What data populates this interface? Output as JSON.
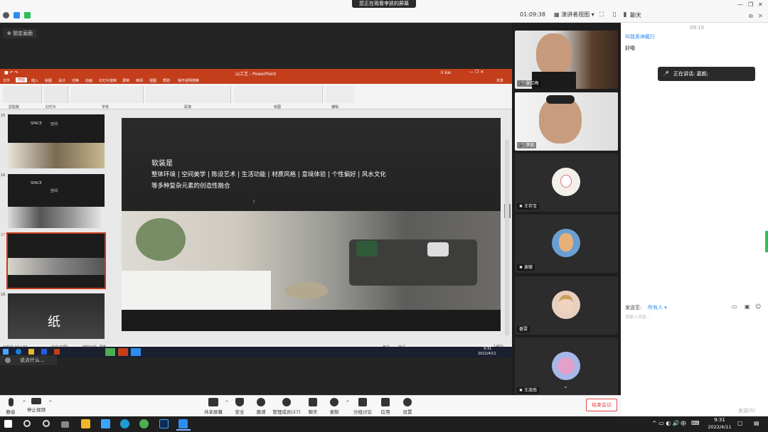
{
  "top": {
    "share_banner": "您正在观看李凯的屏幕",
    "timer": "01:09:38",
    "view_mode": "演讲者视图",
    "chat_title": "聊天"
  },
  "meeting": {
    "lock_view": "锁定画面"
  },
  "ppt": {
    "doc_title": "山工艺 - PowerPoint",
    "user": "li kai",
    "tabs": [
      "文件",
      "开始",
      "插入",
      "绘图",
      "设计",
      "切换",
      "动画",
      "幻灯片放映",
      "录制",
      "审阅",
      "视图",
      "帮助",
      "操作说明搜索"
    ],
    "share_label": "共享",
    "ribbon_groups": [
      "剪贴板",
      "幻灯片",
      "字体",
      "段落",
      "绘图",
      "编辑"
    ],
    "thumbs": [
      {
        "num": "15",
        "title": "SPACE",
        "sub": "空间"
      },
      {
        "num": "16",
        "title": "SPACE",
        "sub": "空间"
      },
      {
        "num": "17",
        "title": "",
        "sub": ""
      },
      {
        "num": "18",
        "title": "纸",
        "sub": ""
      }
    ],
    "slide": {
      "heading": "软装是",
      "line1": "整体环境 | 空间美学 | 陈设艺术 | 生活功能 | 材质风格 | 意境体验 | 个性偏好 | 风水文化",
      "line2": "等多种复杂元素的创造性融合"
    },
    "status": {
      "slide_pos": "幻灯片 17 / 37",
      "lang": "中文(中国)",
      "accessibility": "辅助功能: 调查",
      "notes": "备注",
      "comments": "批注",
      "zoom": "146%"
    },
    "taskbar_time": "9:31",
    "taskbar_date": "2022/4/11"
  },
  "notes_input": "说点什么...",
  "participants": [
    {
      "name": "张红梅"
    },
    {
      "name": "李凯"
    },
    {
      "name": "王存宝"
    },
    {
      "name": "谢德"
    },
    {
      "name": "香雯"
    },
    {
      "name": "王淑南"
    }
  ],
  "chat": {
    "time": "09:15",
    "sender": "叫我男神戴行",
    "message": "好嘞",
    "speaking": "正在讲话: 嘉颜;",
    "send_to_label": "发送至:",
    "send_to_value": "所有人",
    "hint": "请输入消息...",
    "send_button": "发送(S)"
  },
  "toolbar": {
    "mute": "静音",
    "stop_video": "停止视频",
    "share": "共享屏幕",
    "security": "安全",
    "invite": "邀请",
    "members": "管理成员(27)",
    "chat": "聊天",
    "record": "录制",
    "breakout": "分组讨论",
    "apps": "应用",
    "settings": "设置",
    "end": "结束会议"
  },
  "windows": {
    "ime": "中",
    "time": "9:31",
    "date": "2022/4/11"
  },
  "colors": {
    "ppt_accent": "#c43e1c",
    "link": "#2d8cf0",
    "end_meeting": "#e5484d"
  }
}
